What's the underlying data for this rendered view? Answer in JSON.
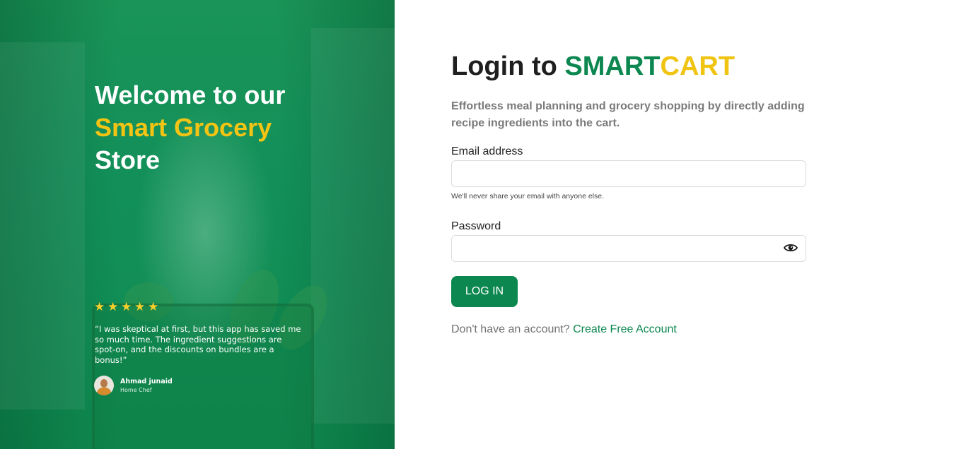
{
  "hero": {
    "title_line1": "Welcome to our",
    "title_accent": "Smart Grocery",
    "title_line3": "Store",
    "rating": 5,
    "review_quote": "“I was skeptical at first, but this app has saved me so much time. The ingredient suggestions are spot-on, and the discounts on bundles are a bonus!”",
    "reviewer_name": "Ahmad junaid",
    "reviewer_role": "Home Chef"
  },
  "login": {
    "title_prefix": "Login to ",
    "brand_part1": "SMART",
    "brand_part2": "CART",
    "subtitle": "Effortless meal planning and grocery shopping by directly adding recipe ingredients into the cart.",
    "email_label": "Email address",
    "email_value": "",
    "email_help": "We'll never share your email with anyone else.",
    "password_label": "Password",
    "password_value": "",
    "password_toggle_icon": "eye-icon",
    "login_button": "LOG IN",
    "signup_prompt": "Don't have an account?",
    "signup_link": "Create Free Account"
  },
  "colors": {
    "brand_green": "#0b874f",
    "brand_yellow": "#f0c412",
    "hero_green": "#0f8a50"
  }
}
